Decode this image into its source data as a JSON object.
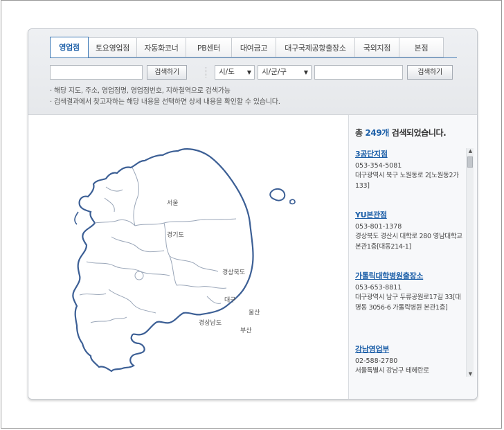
{
  "tabs": [
    "영업점",
    "토요영업점",
    "자동화코너",
    "PB센터",
    "대여금고",
    "대구국제공항출장소",
    "국외지점",
    "본점"
  ],
  "active_tab": "영업점",
  "search": {
    "keyword_value": "",
    "button_label": "검색하기",
    "city_select": "시/도",
    "district_select": "시/군/구",
    "district_value": "",
    "button2_label": "검색하기"
  },
  "hints": [
    "· 해당 지도, 주소, 영업점명, 영업점번호, 지하철역으로 검색가능",
    "· 검색결과에서 찾고자하는 해당 내용을 선택하면 상세 내용을 확인할 수 있습니다."
  ],
  "map": {
    "regions": [
      "서울",
      "경기도",
      "경상북도",
      "대구",
      "경상남도",
      "울산",
      "부산"
    ]
  },
  "results": {
    "prefix": "총 ",
    "count": "249개",
    "suffix": " 검색되었습니다.",
    "items": [
      {
        "name": "3공단지점",
        "tel": "053-354-5081",
        "addr": "대구광역시 북구 노원동로 2[노원동2가 133]"
      },
      {
        "name": "YU본관점",
        "tel": "053-801-1378",
        "addr": "경상북도 경산시 대학로 280 영남대학교 본관1층[대동214-1]"
      },
      {
        "name": "가톨릭대학병원출장소",
        "tel": "053-653-8811",
        "addr": "대구광역시 남구 두류공원로17길 33[대명동 3056-6 가톨릭병원 본관1층]"
      },
      {
        "name": "강남영업부",
        "tel": "02-588-2780",
        "addr": "서울특별시 강남구 테헤란로"
      }
    ]
  }
}
